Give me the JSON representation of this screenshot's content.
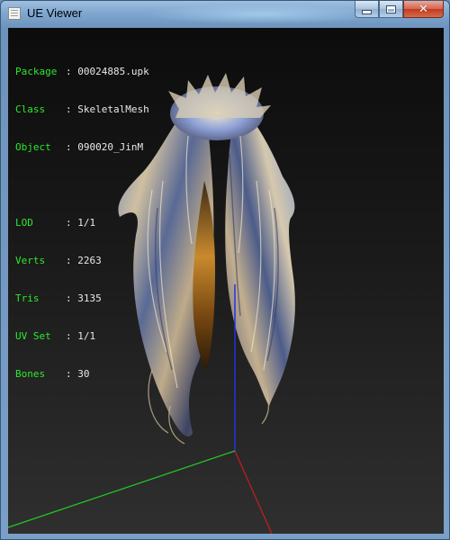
{
  "window": {
    "title": "UE Viewer"
  },
  "caption_buttons": {
    "minimize": "minimize",
    "maximize": "maximize",
    "close": "close"
  },
  "mesh_info": {
    "package": {
      "label": "Package",
      "value": "00024885.upk"
    },
    "class": {
      "label": "Class",
      "value": "SkeletalMesh"
    },
    "object": {
      "label": "Object",
      "value": "090020_JinM"
    },
    "lod": {
      "label": "LOD",
      "value": "1/1"
    },
    "verts": {
      "label": "Verts",
      "value": "2263"
    },
    "tris": {
      "label": "Tris",
      "value": "3135"
    },
    "uv_set": {
      "label": "UV Set",
      "value": "1/1"
    },
    "bones": {
      "label": "Bones",
      "value": "30"
    }
  },
  "colors": {
    "label_green": "#2ee82e",
    "value_white": "#e8e8e8",
    "axis_x": "#c81e1e",
    "axis_y": "#21d021",
    "axis_z": "#2332e0"
  },
  "icons": {
    "app": "app-window-icon",
    "minimize": "minimize-icon",
    "maximize": "maximize-icon",
    "close": "close-icon"
  }
}
